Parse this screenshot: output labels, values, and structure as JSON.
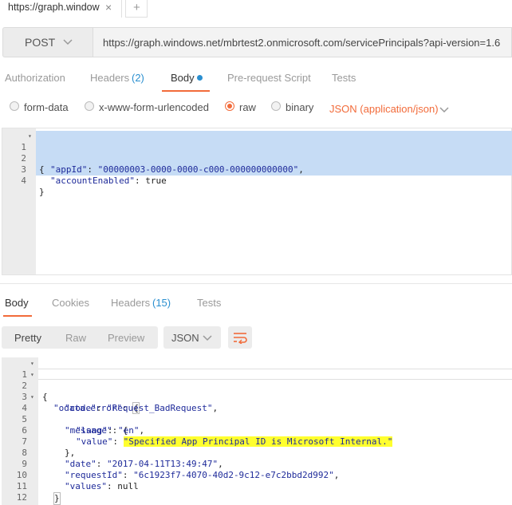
{
  "tab": {
    "title": "https://graph.window",
    "close": "×",
    "new_tab": "+"
  },
  "request": {
    "method": "POST",
    "url": "https://graph.windows.net/mbrtest2.onmicrosoft.com/servicePrincipals?api-version=1.6",
    "tabs": {
      "authorization": "Authorization",
      "headers": "Headers",
      "headers_count": "(2)",
      "body": "Body",
      "pre_request": "Pre-request Script",
      "tests": "Tests"
    },
    "body_modes": {
      "form_data": "form-data",
      "urlencoded": "x-www-form-urlencoded",
      "raw": "raw",
      "binary": "binary",
      "selected": "raw"
    },
    "content_type": "JSON (application/json)",
    "editor_lines": [
      "1",
      "2",
      "3",
      "4"
    ],
    "body_code": {
      "open": "{",
      "k1": "\"appId\"",
      "v1": "\"00000003-0000-0000-c000-000000000000\"",
      "k2": "\"accountEnabled\"",
      "v2": "true",
      "close": "}"
    }
  },
  "response": {
    "tabs": {
      "body": "Body",
      "cookies": "Cookies",
      "headers": "Headers",
      "headers_count": "(15)",
      "tests": "Tests"
    },
    "view": {
      "pretty": "Pretty",
      "raw": "Raw",
      "preview": "Preview",
      "selected": "Pretty"
    },
    "format": "JSON",
    "line_numbers": [
      "1",
      "2",
      "3",
      "4",
      "5",
      "6",
      "7",
      "8",
      "9",
      "10",
      "11",
      "12"
    ],
    "code": {
      "l1": "{",
      "k_error": "\"odata.error\"",
      "k_code": "\"code\"",
      "v_code": "\"Request_BadRequest\"",
      "k_message": "\"message\"",
      "k_lang": "\"lang\"",
      "v_lang": "\"en\"",
      "k_value": "\"value\"",
      "v_value": "\"Specified App Principal ID is Microsoft Internal.\"",
      "close_message": "},",
      "k_date": "\"date\"",
      "v_date": "\"2017-04-11T13:49:47\"",
      "k_request": "\"requestId\"",
      "v_request": "\"6c1923f7-4070-40d2-9c12-e7c2bbd2d992\"",
      "k_values": "\"values\"",
      "v_values": "null",
      "close_error": "}",
      "l12": "}"
    }
  },
  "colors": {
    "accent": "#f26b3a",
    "link": "#2a8fd0",
    "highlight": "#ffff2e",
    "selection": "#c6dcf5",
    "string": "#1f2b9a"
  },
  "icons": {
    "method_dropdown": "chevron-down-icon",
    "content_type_dropdown": "chevron-down-icon",
    "wrap": "wrap-lines-icon"
  }
}
